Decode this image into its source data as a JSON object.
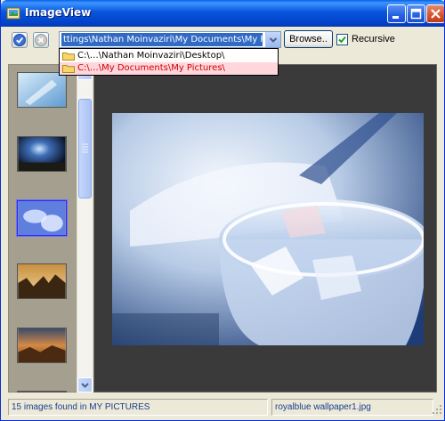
{
  "window": {
    "title": "ImageView",
    "icons": {
      "app": "image-app-icon",
      "minimize": "minimize-icon",
      "maximize": "maximize-icon",
      "close": "close-icon"
    }
  },
  "toolbar": {
    "ok_icon": "checkmark-icon",
    "cancel_icon": "cancel-icon",
    "path_value": "ttings\\Nathan Moinvaziri\\My Documents\\My Pictures\\",
    "browse_label": "Browse..",
    "recursive_label": "Recursive",
    "recursive_checked": true
  },
  "dropdown": {
    "items": [
      {
        "label": "C:\\…\\Nathan Moinvaziri\\Desktop\\",
        "icon": "folder-icon",
        "selected": false
      },
      {
        "label": "C:\\…\\My Documents\\My Pictures\\",
        "icon": "folder-icon",
        "selected": true
      }
    ]
  },
  "thumbnails": {
    "items": [
      {
        "name": "thumb-blue-abstract",
        "selected": false
      },
      {
        "name": "thumb-night-glow",
        "selected": false
      },
      {
        "name": "thumb-royalblue-glass",
        "selected": true
      },
      {
        "name": "thumb-sunset-rocks",
        "selected": false
      },
      {
        "name": "thumb-desert-sunset",
        "selected": false
      }
    ]
  },
  "status": {
    "count_text": "15 images found in MY PICTURES",
    "file_name": "royalblue wallpaper1.jpg"
  },
  "colors": {
    "titlebar": "#0855dd",
    "selection": "#316ac5",
    "dropdown_selected_bg": "#ffd6dc",
    "dropdown_selected_text": "#d00000",
    "preview_bg": "#3a3a3a",
    "status_text": "#1a3d8e"
  }
}
